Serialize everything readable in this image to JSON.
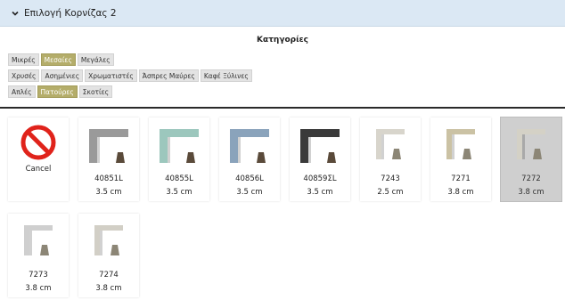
{
  "header": {
    "title": "Επιλογή Κορνίζας 2",
    "icon": "chevron-down-icon"
  },
  "categories": {
    "title": "Κατηγορίες",
    "rows": [
      [
        {
          "label": "Μικρές",
          "active": false
        },
        {
          "label": "Μεσαίες",
          "active": true
        },
        {
          "label": "Μεγάλες",
          "active": false
        }
      ],
      [
        {
          "label": "Χρυσές",
          "active": false
        },
        {
          "label": "Ασημένιες",
          "active": false
        },
        {
          "label": "Χρωματιστές",
          "active": false
        },
        {
          "label": "Άσπρες Μαύρες",
          "active": false
        },
        {
          "label": "Καφέ Ξύλινες",
          "active": false
        }
      ],
      [
        {
          "label": "Απλές",
          "active": false
        },
        {
          "label": "Πατούρες",
          "active": true
        },
        {
          "label": "Σκοτίες",
          "active": false
        }
      ]
    ]
  },
  "frames": {
    "cancel_label": "Cancel",
    "items": [
      {
        "code": "40851L",
        "size": "3.5 cm",
        "color": "#9a9a9a",
        "style": "thick",
        "selected": false
      },
      {
        "code": "40855L",
        "size": "3.5 cm",
        "color": "#9cc7bd",
        "style": "thick",
        "selected": false
      },
      {
        "code": "40856L",
        "size": "3.5 cm",
        "color": "#8aa3bb",
        "style": "thick",
        "selected": false
      },
      {
        "code": "40859ΣL",
        "size": "3.5 cm",
        "color": "#3a3a3a",
        "style": "thick",
        "selected": false
      },
      {
        "code": "7243",
        "size": "2.5 cm",
        "color": "#d8d5cc",
        "style": "thin",
        "selected": false
      },
      {
        "code": "7271",
        "size": "3.8 cm",
        "color": "#cbc2a4",
        "style": "thin",
        "selected": false
      },
      {
        "code": "7272",
        "size": "3.8 cm",
        "color": "#d4d1c6",
        "style": "thin",
        "selected": true
      },
      {
        "code": "7273",
        "size": "3.8 cm",
        "color": "#cfcfcf",
        "style": "thin",
        "selected": false
      },
      {
        "code": "7274",
        "size": "3.8 cm",
        "color": "#d2cfc6",
        "style": "thin",
        "selected": false
      }
    ]
  },
  "colors": {
    "header_bg": "#dbe8f4",
    "active_btn": "#b4ad6a",
    "cancel_red": "#e0231b"
  }
}
